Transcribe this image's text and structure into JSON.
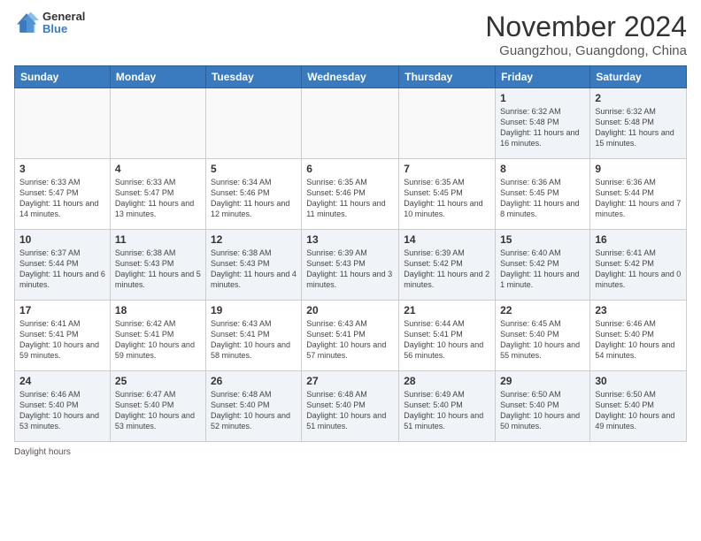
{
  "header": {
    "logo_general": "General",
    "logo_blue": "Blue",
    "title": "November 2024",
    "subtitle": "Guangzhou, Guangdong, China"
  },
  "days_of_week": [
    "Sunday",
    "Monday",
    "Tuesday",
    "Wednesday",
    "Thursday",
    "Friday",
    "Saturday"
  ],
  "weeks": [
    [
      {
        "day": "",
        "info": ""
      },
      {
        "day": "",
        "info": ""
      },
      {
        "day": "",
        "info": ""
      },
      {
        "day": "",
        "info": ""
      },
      {
        "day": "",
        "info": ""
      },
      {
        "day": "1",
        "info": "Sunrise: 6:32 AM\nSunset: 5:48 PM\nDaylight: 11 hours and 16 minutes."
      },
      {
        "day": "2",
        "info": "Sunrise: 6:32 AM\nSunset: 5:48 PM\nDaylight: 11 hours and 15 minutes."
      }
    ],
    [
      {
        "day": "3",
        "info": "Sunrise: 6:33 AM\nSunset: 5:47 PM\nDaylight: 11 hours and 14 minutes."
      },
      {
        "day": "4",
        "info": "Sunrise: 6:33 AM\nSunset: 5:47 PM\nDaylight: 11 hours and 13 minutes."
      },
      {
        "day": "5",
        "info": "Sunrise: 6:34 AM\nSunset: 5:46 PM\nDaylight: 11 hours and 12 minutes."
      },
      {
        "day": "6",
        "info": "Sunrise: 6:35 AM\nSunset: 5:46 PM\nDaylight: 11 hours and 11 minutes."
      },
      {
        "day": "7",
        "info": "Sunrise: 6:35 AM\nSunset: 5:45 PM\nDaylight: 11 hours and 10 minutes."
      },
      {
        "day": "8",
        "info": "Sunrise: 6:36 AM\nSunset: 5:45 PM\nDaylight: 11 hours and 8 minutes."
      },
      {
        "day": "9",
        "info": "Sunrise: 6:36 AM\nSunset: 5:44 PM\nDaylight: 11 hours and 7 minutes."
      }
    ],
    [
      {
        "day": "10",
        "info": "Sunrise: 6:37 AM\nSunset: 5:44 PM\nDaylight: 11 hours and 6 minutes."
      },
      {
        "day": "11",
        "info": "Sunrise: 6:38 AM\nSunset: 5:43 PM\nDaylight: 11 hours and 5 minutes."
      },
      {
        "day": "12",
        "info": "Sunrise: 6:38 AM\nSunset: 5:43 PM\nDaylight: 11 hours and 4 minutes."
      },
      {
        "day": "13",
        "info": "Sunrise: 6:39 AM\nSunset: 5:43 PM\nDaylight: 11 hours and 3 minutes."
      },
      {
        "day": "14",
        "info": "Sunrise: 6:39 AM\nSunset: 5:42 PM\nDaylight: 11 hours and 2 minutes."
      },
      {
        "day": "15",
        "info": "Sunrise: 6:40 AM\nSunset: 5:42 PM\nDaylight: 11 hours and 1 minute."
      },
      {
        "day": "16",
        "info": "Sunrise: 6:41 AM\nSunset: 5:42 PM\nDaylight: 11 hours and 0 minutes."
      }
    ],
    [
      {
        "day": "17",
        "info": "Sunrise: 6:41 AM\nSunset: 5:41 PM\nDaylight: 10 hours and 59 minutes."
      },
      {
        "day": "18",
        "info": "Sunrise: 6:42 AM\nSunset: 5:41 PM\nDaylight: 10 hours and 59 minutes."
      },
      {
        "day": "19",
        "info": "Sunrise: 6:43 AM\nSunset: 5:41 PM\nDaylight: 10 hours and 58 minutes."
      },
      {
        "day": "20",
        "info": "Sunrise: 6:43 AM\nSunset: 5:41 PM\nDaylight: 10 hours and 57 minutes."
      },
      {
        "day": "21",
        "info": "Sunrise: 6:44 AM\nSunset: 5:41 PM\nDaylight: 10 hours and 56 minutes."
      },
      {
        "day": "22",
        "info": "Sunrise: 6:45 AM\nSunset: 5:40 PM\nDaylight: 10 hours and 55 minutes."
      },
      {
        "day": "23",
        "info": "Sunrise: 6:46 AM\nSunset: 5:40 PM\nDaylight: 10 hours and 54 minutes."
      }
    ],
    [
      {
        "day": "24",
        "info": "Sunrise: 6:46 AM\nSunset: 5:40 PM\nDaylight: 10 hours and 53 minutes."
      },
      {
        "day": "25",
        "info": "Sunrise: 6:47 AM\nSunset: 5:40 PM\nDaylight: 10 hours and 53 minutes."
      },
      {
        "day": "26",
        "info": "Sunrise: 6:48 AM\nSunset: 5:40 PM\nDaylight: 10 hours and 52 minutes."
      },
      {
        "day": "27",
        "info": "Sunrise: 6:48 AM\nSunset: 5:40 PM\nDaylight: 10 hours and 51 minutes."
      },
      {
        "day": "28",
        "info": "Sunrise: 6:49 AM\nSunset: 5:40 PM\nDaylight: 10 hours and 51 minutes."
      },
      {
        "day": "29",
        "info": "Sunrise: 6:50 AM\nSunset: 5:40 PM\nDaylight: 10 hours and 50 minutes."
      },
      {
        "day": "30",
        "info": "Sunrise: 6:50 AM\nSunset: 5:40 PM\nDaylight: 10 hours and 49 minutes."
      }
    ]
  ],
  "footer": {
    "daylight_label": "Daylight hours"
  }
}
